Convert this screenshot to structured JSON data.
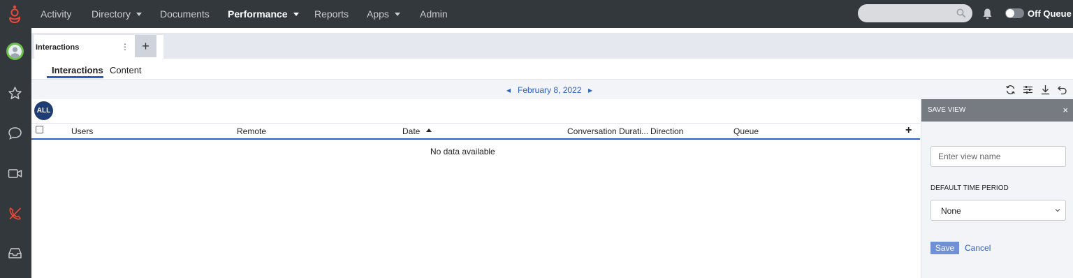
{
  "nav": {
    "items": [
      {
        "label": "Activity",
        "has_caret": false,
        "active": false
      },
      {
        "label": "Directory",
        "has_caret": true,
        "active": false
      },
      {
        "label": "Documents",
        "has_caret": false,
        "active": false
      },
      {
        "label": "Performance",
        "has_caret": true,
        "active": true
      },
      {
        "label": "Reports",
        "has_caret": false,
        "active": false
      },
      {
        "label": "Apps",
        "has_caret": true,
        "active": false
      },
      {
        "label": "Admin",
        "has_caret": false,
        "active": false
      }
    ],
    "search_placeholder": "",
    "status_label": "Off Queue",
    "status_on": false
  },
  "rail": {
    "icons": [
      "avatar",
      "star-icon",
      "chat-icon",
      "video-icon",
      "phone-icon",
      "inbox-icon"
    ],
    "accent_color": "#e8483a",
    "avatar_color": "#6cc04a"
  },
  "workspace": {
    "tab_label": "Interactions",
    "add_label": "+"
  },
  "subtabs": [
    {
      "label": "Interactions",
      "active": true
    },
    {
      "label": "Content",
      "active": false
    }
  ],
  "date_bar": {
    "date": "February 8, 2022"
  },
  "grid": {
    "filter_badge": "ALL",
    "columns": [
      "Users",
      "Remote",
      "Date",
      "Conversation Durati...",
      "Direction",
      "Queue"
    ],
    "sorted_column": "Date",
    "sort_direction": "ascending",
    "empty_message": "No data available"
  },
  "save_view": {
    "title": "SAVE VIEW",
    "close_label": "×",
    "name_placeholder": "Enter view name",
    "period_label": "DEFAULT TIME PERIOD",
    "period_value": "None",
    "save_label": "Save",
    "cancel_label": "Cancel"
  },
  "colors": {
    "nav_bg": "#33383d",
    "accent_blue": "#2a60c8",
    "badge_navy": "#1e3d73",
    "panel_header": "#767b82"
  }
}
